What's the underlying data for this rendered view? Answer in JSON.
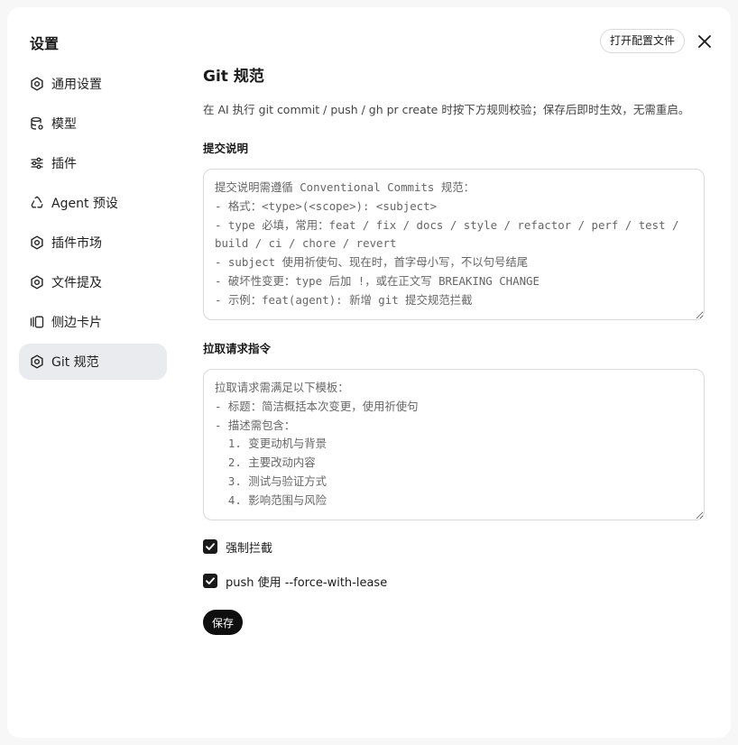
{
  "sidebar": {
    "title": "设置",
    "items": [
      {
        "label": "通用设置",
        "icon": "gear-icon",
        "active": false
      },
      {
        "label": "模型",
        "icon": "database-icon",
        "active": false
      },
      {
        "label": "插件",
        "icon": "sliders-icon",
        "active": false
      },
      {
        "label": "Agent 预设",
        "icon": "recycle-icon",
        "active": false
      },
      {
        "label": "插件市场",
        "icon": "gear-icon",
        "active": false
      },
      {
        "label": "文件提及",
        "icon": "gear-icon",
        "active": false
      },
      {
        "label": "侧边卡片",
        "icon": "cards-icon",
        "active": false
      },
      {
        "label": "Git 规范",
        "icon": "gear-icon",
        "active": true
      }
    ]
  },
  "header": {
    "open_config_label": "打开配置文件",
    "close_icon": "close-icon"
  },
  "main": {
    "title": "Git 规范",
    "description": "在 AI 执行 git commit / push / gh pr create 时按下方规则校验；保存后即时生效，无需重启。",
    "commit_section": {
      "label": "提交说明",
      "value": "提交说明需遵循 Conventional Commits 规范：\n- 格式：<type>(<scope>): <subject>\n- type 必填，常用：feat / fix / docs / style / refactor / perf / test / build / ci / chore / revert\n- subject 使用祈使句、现在时，首字母小写，不以句号结尾\n- 破坏性变更：type 后加 !，或在正文写 BREAKING CHANGE\n- 示例：feat(agent): 新增 git 提交规范拦截"
    },
    "pr_section": {
      "label": "拉取请求指令",
      "value": "拉取请求需满足以下模板：\n- 标题：简洁概括本次变更，使用祈使句\n- 描述需包含：\n  1. 变更动机与背景\n  2. 主要改动内容\n  3. 测试与验证方式\n  4. 影响范围与风险"
    },
    "options": [
      {
        "label": "强制拦截",
        "checked": true
      },
      {
        "label": "push 使用 --force-with-lease",
        "checked": true
      }
    ],
    "save_label": "保存"
  }
}
